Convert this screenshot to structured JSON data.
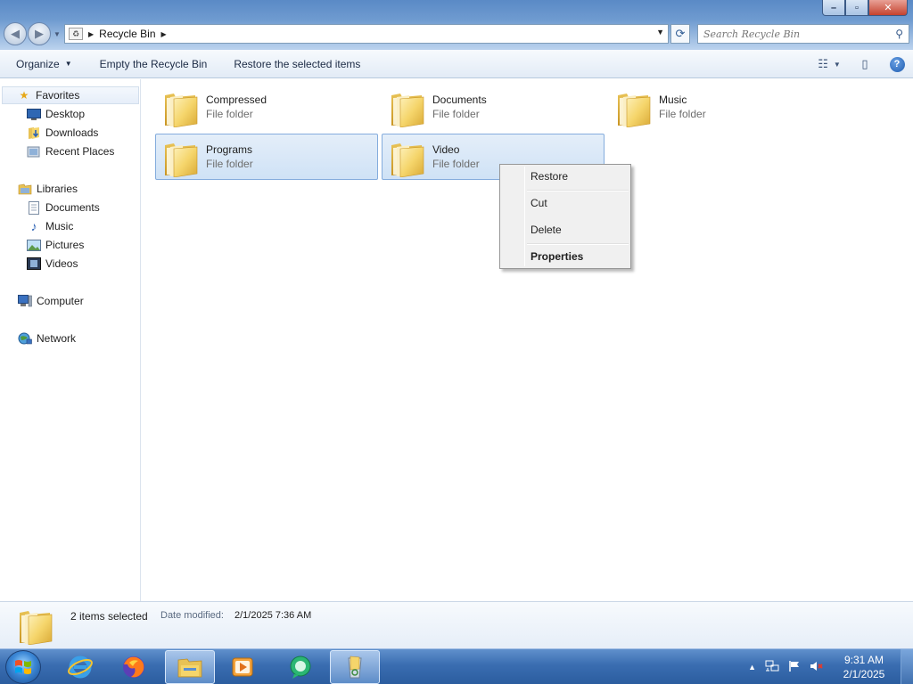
{
  "window": {
    "caption_buttons": {
      "minimize": "–",
      "maximize": "▫",
      "close": "✕"
    },
    "address": {
      "location": "Recycle Bin"
    },
    "search": {
      "placeholder": "Search Recycle Bin"
    }
  },
  "commandbar": {
    "organize": "Organize",
    "empty": "Empty the Recycle Bin",
    "restore": "Restore the selected items"
  },
  "navpane": {
    "favorites": "Favorites",
    "favorites_items": [
      "Desktop",
      "Downloads",
      "Recent Places"
    ],
    "libraries": "Libraries",
    "libraries_items": [
      "Documents",
      "Music",
      "Pictures",
      "Videos"
    ],
    "computer": "Computer",
    "network": "Network"
  },
  "content": {
    "items": [
      {
        "name": "Compressed",
        "type": "File folder",
        "selected": false
      },
      {
        "name": "Documents",
        "type": "File folder",
        "selected": false
      },
      {
        "name": "Music",
        "type": "File folder",
        "selected": false
      },
      {
        "name": "Programs",
        "type": "File folder",
        "selected": true
      },
      {
        "name": "Video",
        "type": "File folder",
        "selected": true
      }
    ]
  },
  "context_menu": {
    "items": [
      "Restore",
      "Cut",
      "Delete",
      "Properties"
    ]
  },
  "details": {
    "count": "2 items selected",
    "date_label": "Date modified:",
    "date_value": "2/1/2025 7:36 AM"
  },
  "taskbar": {
    "apps": [
      "internet-explorer",
      "firefox",
      "file-explorer",
      "media-player",
      "messenger",
      "recycle-bin-window"
    ],
    "clock_time": "9:31 AM",
    "clock_date": "2/1/2025"
  },
  "colors": {
    "selection_fill": "#cfe2f6",
    "selection_border": "#84acdd",
    "taskbar": "#2b5d9f",
    "folder": "#f5d56b"
  }
}
